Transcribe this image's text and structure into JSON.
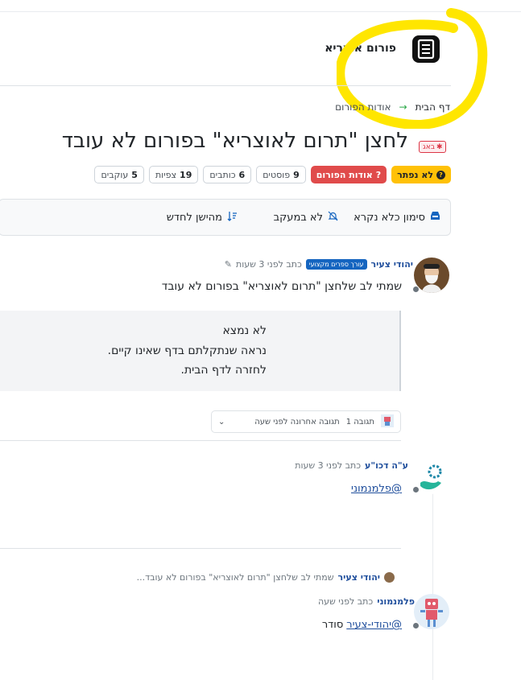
{
  "colors": {
    "accent": "#ffc107",
    "danger": "#e04b4b",
    "brand_blue": "#1565c0",
    "highlight": "#ffe600"
  },
  "header": {
    "forum_name": "פורום אוצריא",
    "logo_icon": "book-icon"
  },
  "breadcrumb": {
    "home": "דף הבית",
    "current": "אודות הפורום"
  },
  "topic": {
    "bug_badge": "באג",
    "title": "לחצן \"תרום לאוצריא\" בפורום לא עובד",
    "tags": {
      "unsolved": "לא נפתר",
      "category": "אודות הפורום",
      "posts_count": "9",
      "posts_label": "פוסטים",
      "writers_count": "6",
      "writers_label": "כותבים",
      "views_count": "19",
      "views_label": "צפיות",
      "followers_count": "5",
      "followers_label": "עוקבים"
    }
  },
  "toolbar": {
    "mark_unread": "סימון כלא נקרא",
    "not_watching": "לא במעקב",
    "sort": "מהישן לחדש"
  },
  "post1": {
    "author": "יהודי צעיר",
    "group_badge": "עורך ספרים מקצועי",
    "meta": "כתב לפני 3 שעות",
    "text": "שמתי לב שלחצן \"תרום לאוצריא\" בפורום לא עובד",
    "quote": {
      "line1": "לא נמצא",
      "line2": "נראה שנתקלתם בדף שאינו קיים.",
      "line3": "לחזרה לדף הבית."
    },
    "replies_count": "תגובה 1",
    "last_reply": "תגובה אחרונה לפני שעה"
  },
  "post2": {
    "author": "ע\"ה דכו\"ע",
    "meta": "כתב לפני 3 שעות",
    "mention": "@פלמנמוני"
  },
  "post3": {
    "reply_to_author": "יהודי צעיר",
    "reply_to_excerpt": "שמתי לב שלחצן \"תרום לאוצריא\" בפורום לא עובד...",
    "author": "פלמנמוני",
    "meta": "כתב לפני שעה",
    "mention": "@יהודי-צעיר",
    "text_after": "סודר"
  }
}
